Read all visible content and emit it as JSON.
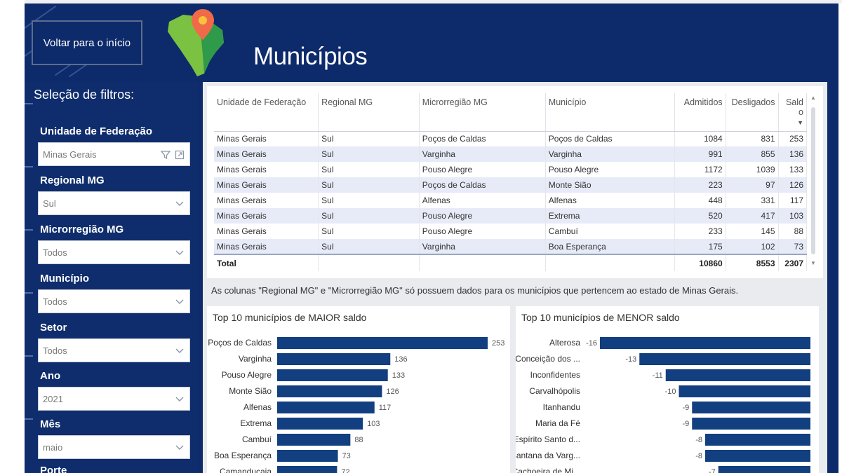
{
  "header": {
    "back_button": "Voltar para o início",
    "title": "Municípios"
  },
  "sidebar": {
    "heading": "Seleção de filtros:",
    "filters": [
      {
        "label": "Unidade de Federação",
        "value": "Minas Gerais"
      },
      {
        "label": "Regional MG",
        "value": "Sul"
      },
      {
        "label": "Microrregião MG",
        "value": "Todos"
      },
      {
        "label": "Município",
        "value": "Todos"
      },
      {
        "label": "Setor",
        "value": "Todos"
      },
      {
        "label": "Ano",
        "value": "2021"
      },
      {
        "label": "Mês",
        "value": "maio"
      },
      {
        "label": "Porte",
        "value": ""
      }
    ]
  },
  "table": {
    "columns": [
      "Unidade de Federação",
      "Regional MG",
      "Microrregião MG",
      "Município",
      "Admitidos",
      "Desligados",
      "Saldo"
    ],
    "rows": [
      [
        "Minas Gerais",
        "Sul",
        "Poços de Caldas",
        "Poços de Caldas",
        "1084",
        "831",
        "253"
      ],
      [
        "Minas Gerais",
        "Sul",
        "Varginha",
        "Varginha",
        "991",
        "855",
        "136"
      ],
      [
        "Minas Gerais",
        "Sul",
        "Pouso Alegre",
        "Pouso Alegre",
        "1172",
        "1039",
        "133"
      ],
      [
        "Minas Gerais",
        "Sul",
        "Poços de Caldas",
        "Monte Sião",
        "223",
        "97",
        "126"
      ],
      [
        "Minas Gerais",
        "Sul",
        "Alfenas",
        "Alfenas",
        "448",
        "331",
        "117"
      ],
      [
        "Minas Gerais",
        "Sul",
        "Pouso Alegre",
        "Extrema",
        "520",
        "417",
        "103"
      ],
      [
        "Minas Gerais",
        "Sul",
        "Pouso Alegre",
        "Cambuí",
        "233",
        "145",
        "88"
      ],
      [
        "Minas Gerais",
        "Sul",
        "Varginha",
        "Boa Esperança",
        "175",
        "102",
        "73"
      ]
    ],
    "total": [
      "Total",
      "",
      "",
      "",
      "10860",
      "8553",
      "2307"
    ]
  },
  "note": "As colunas \"Regional MG\" e \"Microrregião MG\" só possuem dados para os municípios que pertencem ao estado de Minas Gerais.",
  "colors": {
    "bar": "#123f80",
    "canvas": "#0d2a6b",
    "row_alt": "#e6ebf7"
  },
  "chart_data": [
    {
      "type": "bar",
      "title": "Top 10 municípios de MAIOR saldo",
      "orientation": "horizontal",
      "categories": [
        "Poços de Caldas",
        "Varginha",
        "Pouso Alegre",
        "Monte Sião",
        "Alfenas",
        "Extrema",
        "Cambuí",
        "Boa Esperança",
        "Camanducaia"
      ],
      "values": [
        253,
        136,
        133,
        126,
        117,
        103,
        88,
        73,
        72
      ]
    },
    {
      "type": "bar",
      "title": "Top 10 municípios de MENOR saldo",
      "orientation": "horizontal",
      "categories": [
        "Alterosa",
        "Conceição dos ...",
        "Inconfidentes",
        "Carvalhópolis",
        "Itanhandu",
        "Maria da Fé",
        "Espírito Santo d...",
        "Santana da Varg...",
        "Cachoeira de Mi..."
      ],
      "values": [
        -16,
        -13,
        -11,
        -10,
        -9,
        -9,
        -8,
        -8,
        -7
      ]
    }
  ]
}
